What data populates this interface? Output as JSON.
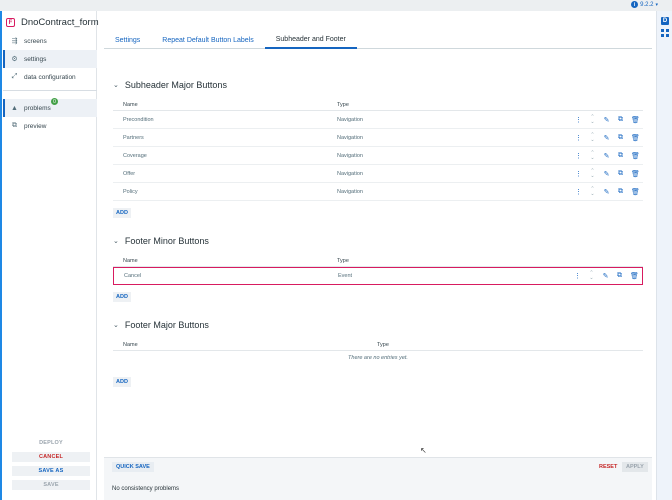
{
  "version": "9.2.2",
  "app": {
    "title": "DnoContract_form"
  },
  "right_strip": {
    "d_label": "D"
  },
  "sidebar": {
    "items": [
      {
        "label": "screens",
        "icon": "screens-icon"
      },
      {
        "label": "settings",
        "icon": "gear-icon"
      },
      {
        "label": "data configuration",
        "icon": "data-config-icon"
      }
    ],
    "items2": [
      {
        "label": "problems",
        "icon": "warning-icon",
        "badge": "0"
      },
      {
        "label": "preview",
        "icon": "open-external-icon"
      }
    ],
    "actions": {
      "deploy": "DEPLOY",
      "cancel": "CANCEL",
      "save_as": "SAVE AS",
      "save": "SAVE"
    }
  },
  "tabs": [
    "Settings",
    "Repeat Default Button Labels",
    "Subheader and Footer"
  ],
  "columns": {
    "name": "Name",
    "type": "Type"
  },
  "sections": {
    "subheader_major": {
      "title": "Subheader Major Buttons",
      "rows": [
        {
          "name": "Precondition",
          "type": "Navigation"
        },
        {
          "name": "Partners",
          "type": "Navigation"
        },
        {
          "name": "Coverage",
          "type": "Navigation"
        },
        {
          "name": "Offer",
          "type": "Navigation"
        },
        {
          "name": "Policy",
          "type": "Navigation"
        }
      ]
    },
    "footer_minor": {
      "title": "Footer Minor Buttons",
      "rows": [
        {
          "name": "Cancel",
          "type": "Event"
        }
      ]
    },
    "footer_major": {
      "title": "Footer Major Buttons",
      "empty": "There are no entries yet."
    }
  },
  "add_label": "ADD",
  "footer": {
    "quick_save": "QUICK SAVE",
    "reset": "RESET",
    "apply": "APPLY",
    "consistency": "No consistency problems"
  }
}
